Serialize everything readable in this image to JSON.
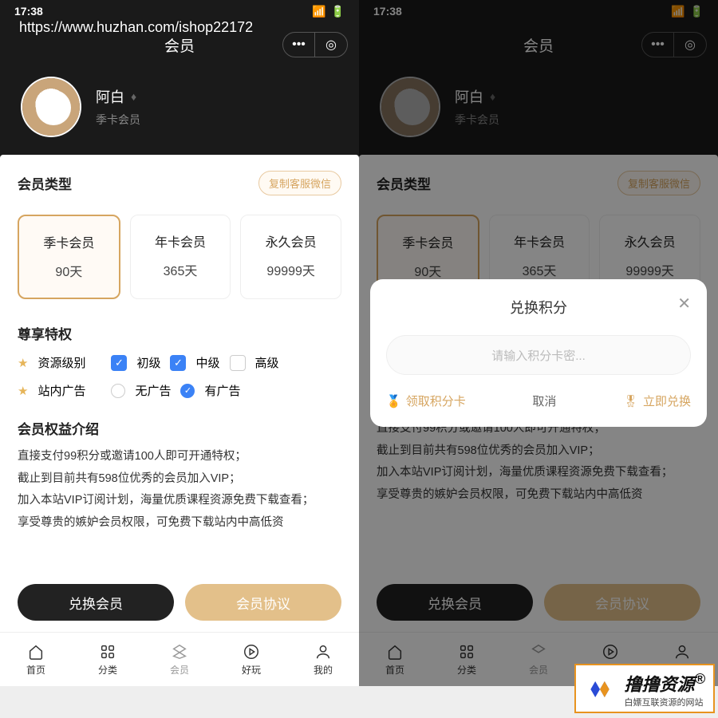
{
  "watermark": "https://www.huzhan.com/ishop22172",
  "status": {
    "time": "17:38"
  },
  "topbar": {
    "title": "会员"
  },
  "user": {
    "name": "阿白",
    "tier": "季卡会员"
  },
  "section": {
    "type_title": "会员类型",
    "copy_btn": "复制客服微信",
    "priv_title": "尊享特权",
    "intro_title": "会员权益介绍"
  },
  "plans": [
    {
      "name": "季卡会员",
      "days": "90天"
    },
    {
      "name": "年卡会员",
      "days": "365天"
    },
    {
      "name": "永久会员",
      "days": "99999天"
    }
  ],
  "privileges": {
    "resource_label": "资源级别",
    "levels": [
      "初级",
      "中级",
      "高级"
    ],
    "ads_label": "站内广告",
    "ad_options": [
      "无广告",
      "有广告"
    ]
  },
  "intro_lines": [
    "直接支付99积分或邀请100人即可开通特权；",
    "截止到目前共有598位优秀的会员加入VIP；",
    "加入本站VIP订阅计划，海量优质课程资源免费下载查看；",
    "享受尊贵的嫉妒会员权限，可免费下载站内中高低资"
  ],
  "buttons": {
    "redeem": "兑换会员",
    "agreement": "会员协议"
  },
  "tabs": [
    "首页",
    "分类",
    "会员",
    "好玩",
    "我的"
  ],
  "modal": {
    "title": "兑换积分",
    "placeholder": "请输入积分卡密...",
    "get_card": "领取积分卡",
    "cancel": "取消",
    "confirm": "立即兑换"
  },
  "logo": {
    "title": "撸撸资源",
    "sub": "白嫖互联资源的网站",
    "reg": "®"
  }
}
